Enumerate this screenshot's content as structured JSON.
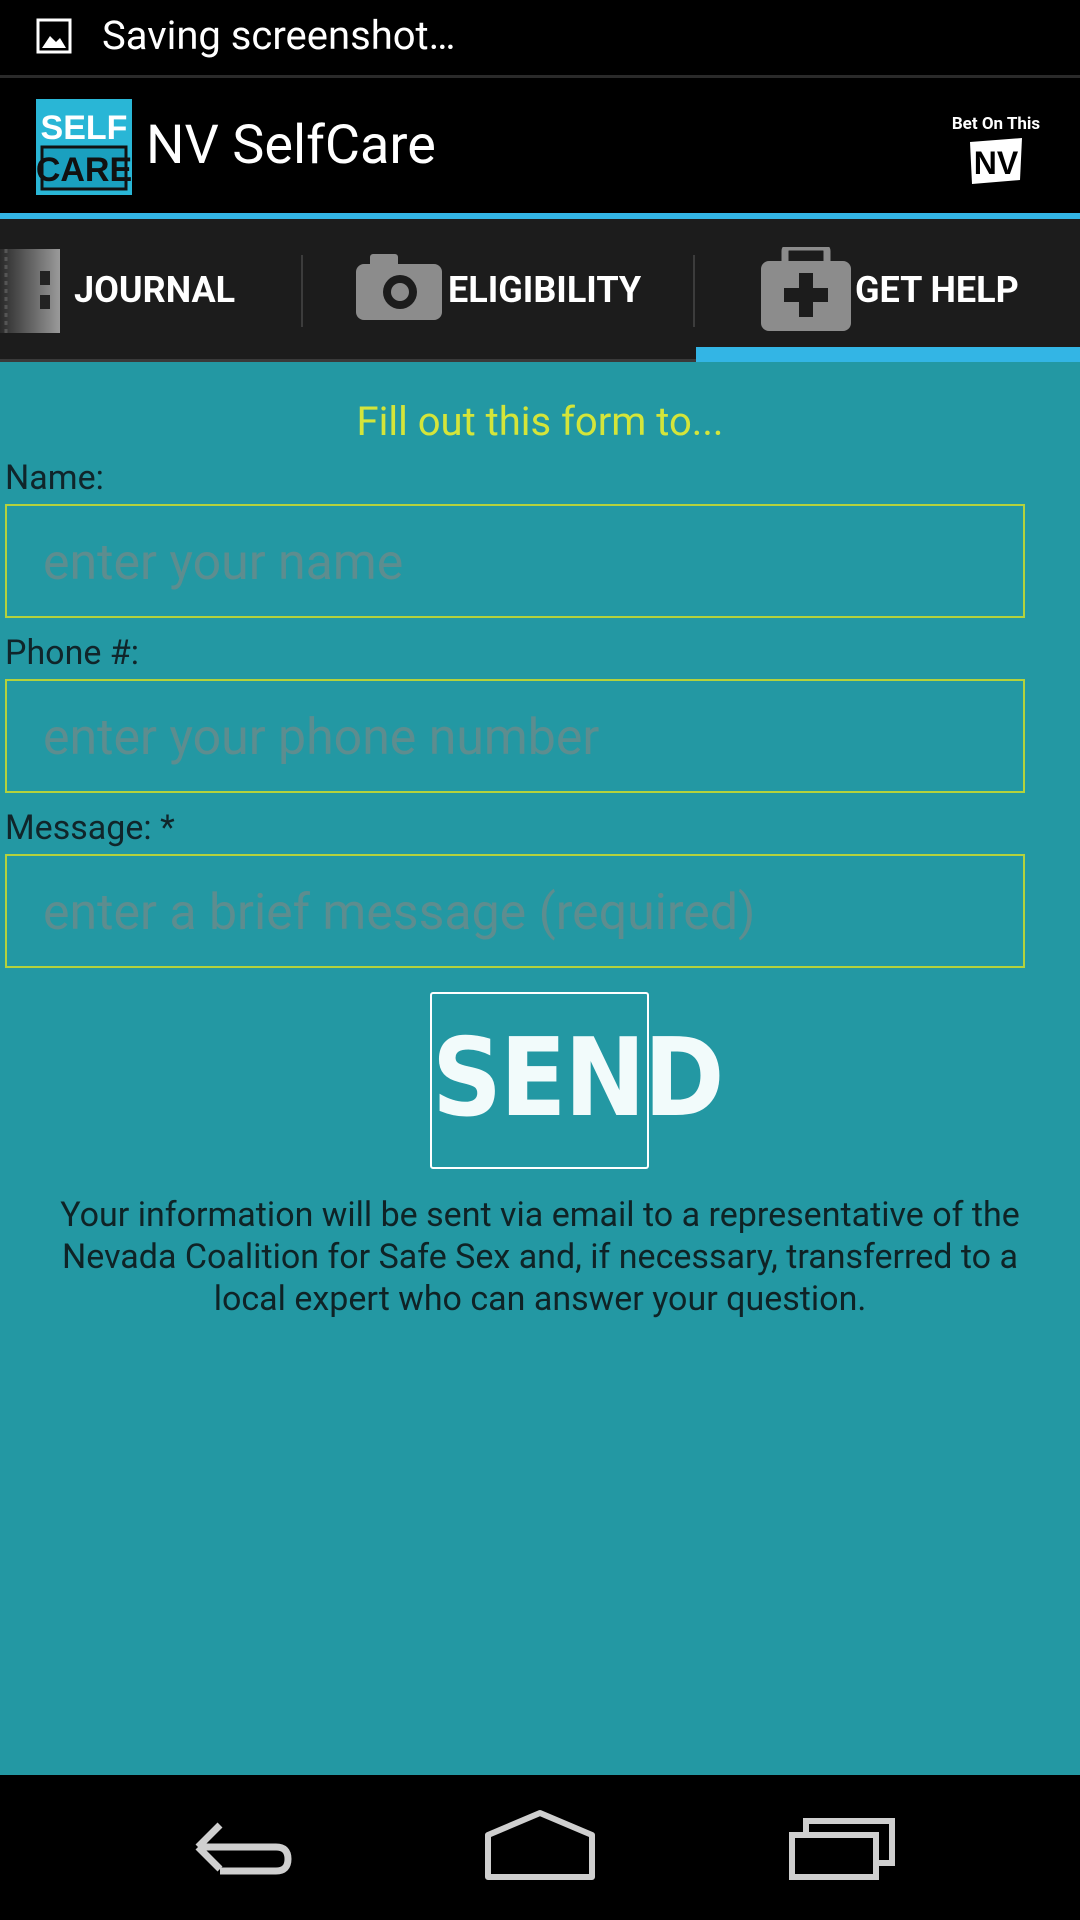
{
  "status_bar": {
    "notification_text": "Saving screenshot…",
    "icon": "image-icon"
  },
  "action_bar": {
    "title": "NV SelfCare",
    "logo_line1": "SELF",
    "logo_line2": "CARE",
    "brand_text": "Bet On This",
    "brand_mark": "NV"
  },
  "tabs": [
    {
      "label": "JOURNAL",
      "icon": "journal-icon",
      "selected": false
    },
    {
      "label": "ELIGIBILITY",
      "icon": "camera-icon",
      "selected": false
    },
    {
      "label": "GET HELP",
      "icon": "medical-kit-icon",
      "selected": true
    }
  ],
  "form": {
    "heading": "Fill out this form to...",
    "name_label": "Name:",
    "name_placeholder": "enter your name",
    "phone_label": "Phone #:",
    "phone_placeholder": "enter your phone number",
    "message_label": "Message: *",
    "message_placeholder": "enter a brief message (required)",
    "send_label": "SEND",
    "info": "Your information will be sent via email to a representative of the Nevada Coalition for Safe Sex and, if necessary, transferred to a local expert who can answer your question."
  },
  "colors": {
    "accent": "#33b5e5",
    "content_bg": "#2398a3",
    "heading": "#d4e53a",
    "field_border": "#b4d23c"
  }
}
